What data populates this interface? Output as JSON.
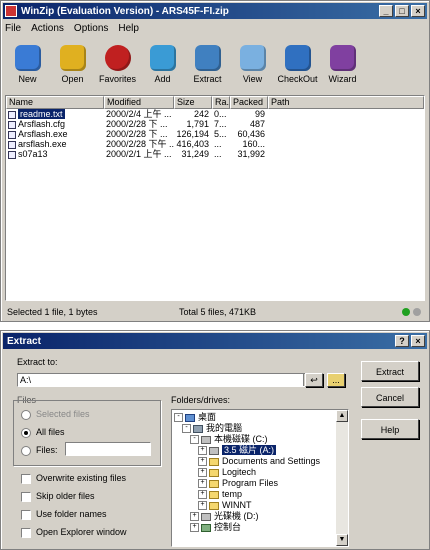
{
  "main_window": {
    "title": "WinZip (Evaluation Version) - ARS45F-FI.zip",
    "min": "_",
    "max": "□",
    "close": "×",
    "menu": [
      "File",
      "Actions",
      "Options",
      "Help"
    ],
    "toolbar": [
      {
        "label": "New",
        "icon": "new-icon",
        "color": "#3a7bd5"
      },
      {
        "label": "Open",
        "icon": "open-icon",
        "color": "#e0b020"
      },
      {
        "label": "Favorites",
        "icon": "favorites-icon",
        "color": "#c02020"
      },
      {
        "label": "Add",
        "icon": "add-icon",
        "color": "#3a9bd5"
      },
      {
        "label": "Extract",
        "icon": "extract-icon",
        "color": "#4080c0"
      },
      {
        "label": "View",
        "icon": "view-icon",
        "color": "#7ab0e0"
      },
      {
        "label": "CheckOut",
        "icon": "checkout-icon",
        "color": "#3070c0"
      },
      {
        "label": "Wizard",
        "icon": "wizard-icon",
        "color": "#8040a0"
      }
    ],
    "columns": [
      "Name",
      "Modified",
      "Size",
      "Ra...",
      "Packed",
      "Path"
    ],
    "files": [
      {
        "name": "readme.txt",
        "modified": "2000/2/4 上午 ...",
        "size": "242",
        "ratio": "0...",
        "packed": "99",
        "selected": true
      },
      {
        "name": "Arsflash.cfg",
        "modified": "2000/2/28 下 ...",
        "size": "1,791",
        "ratio": "7...",
        "packed": "487"
      },
      {
        "name": "Arsflash.exe",
        "modified": "2000/2/28 下 ...",
        "size": "126,194",
        "ratio": "5...",
        "packed": "60,436"
      },
      {
        "name": "arsflash.exe",
        "modified": "2000/2/28 下午 ...",
        "size": "416,403",
        "ratio": "...",
        "packed": "160..."
      },
      {
        "name": "s07a13",
        "modified": "2000/2/1 上午 ...",
        "size": "31,249",
        "ratio": "...",
        "packed": "31,992"
      }
    ],
    "status_left": "Selected 1 file, 1 bytes",
    "status_mid": "Total 5 files, 471KB",
    "lights": [
      "#20a020",
      "#a0a0a0"
    ]
  },
  "extract_dialog": {
    "title": "Extract",
    "help_btn": "?",
    "close_btn": "×",
    "extract_to_label": "Extract to:",
    "extract_to_value": "A:\\",
    "files_group": "Files",
    "radio_selected": "Selected files",
    "radio_all": "All files",
    "radio_files": "Files:",
    "check_overwrite": "Overwrite existing files",
    "check_skip_older": "Skip older files",
    "check_use_folder": "Use folder names",
    "check_open_explorer": "Open Explorer window",
    "folders_label": "Folders/drives:",
    "tree": [
      {
        "label": "桌面",
        "level": 0
      },
      {
        "label": "我的電腦",
        "level": 1
      },
      {
        "label": "本機磁碟 (C:)",
        "level": 2
      },
      {
        "label": "3.5 磁片 (A:)",
        "level": 3,
        "selected": true
      },
      {
        "label": "Documents and Settings",
        "level": 3
      },
      {
        "label": "Logitech",
        "level": 3
      },
      {
        "label": "Program Files",
        "level": 3
      },
      {
        "label": "temp",
        "level": 3
      },
      {
        "label": "WINNT",
        "level": 3
      },
      {
        "label": "光碟機 (D:)",
        "level": 2
      },
      {
        "label": "控制台",
        "level": 2
      }
    ],
    "buttons": [
      "Extract",
      "Cancel",
      "Help"
    ],
    "new_folder": "↩",
    "up_folder": "..."
  }
}
